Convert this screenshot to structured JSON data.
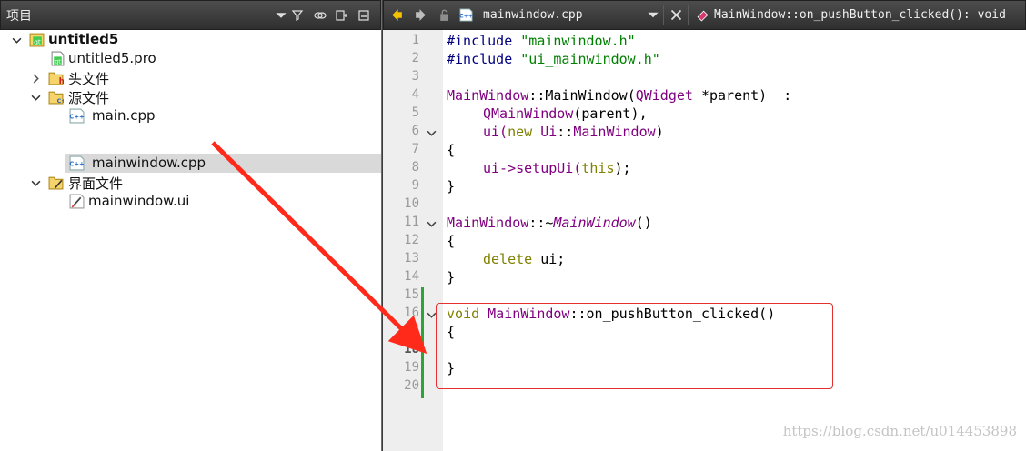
{
  "project_panel": {
    "title": "项目",
    "tree": [
      {
        "label": "untitled5",
        "level": 0,
        "expanded": true,
        "icon": "qt-project-icon",
        "bold": true
      },
      {
        "label": "untitled5.pro",
        "level": 1,
        "icon": "pro-file-icon"
      },
      {
        "label": "头文件",
        "level": 1,
        "expanded": false,
        "icon": "header-folder-icon"
      },
      {
        "label": "源文件",
        "level": 1,
        "expanded": true,
        "icon": "source-folder-icon"
      },
      {
        "label": "main.cpp",
        "level": 2,
        "icon": "cpp-file-icon"
      },
      {
        "label": "mainwindow.cpp",
        "level": 2,
        "icon": "cpp-file-icon",
        "selected": true
      },
      {
        "label": "界面文件",
        "level": 1,
        "expanded": true,
        "icon": "forms-folder-icon"
      },
      {
        "label": "mainwindow.ui",
        "level": 2,
        "icon": "ui-file-icon"
      }
    ]
  },
  "editor": {
    "file_name": "mainwindow.cpp",
    "function_selector": "MainWindow::on_pushButton_clicked(): void",
    "current_line": "18",
    "lines": [
      {
        "num": "1"
      },
      {
        "num": "2"
      },
      {
        "num": "3"
      },
      {
        "num": "4"
      },
      {
        "num": "5"
      },
      {
        "num": "6"
      },
      {
        "num": "7"
      },
      {
        "num": "8"
      },
      {
        "num": "9"
      },
      {
        "num": "10"
      },
      {
        "num": "11"
      },
      {
        "num": "12"
      },
      {
        "num": "13"
      },
      {
        "num": "14"
      },
      {
        "num": "15"
      },
      {
        "num": "16"
      },
      {
        "num": "17"
      },
      {
        "num": "18"
      },
      {
        "num": "19"
      },
      {
        "num": "20"
      }
    ],
    "code": {
      "l1a": "#include ",
      "l1b": "\"mainwindow.h\"",
      "l2a": "#include ",
      "l2b": "\"ui_mainwindow.h\"",
      "l4a": "MainWindow",
      "l4b": "::",
      "l4c": "MainWindow",
      "l4d": "(",
      "l4e": "QWidget",
      "l4f": " *parent)  :",
      "l5a": "QMainWindow",
      "l5b": "(parent),",
      "l6a": "ui(",
      "l6b": "new",
      "l6c": " ",
      "l6d": "Ui",
      "l6e": "::",
      "l6f": "MainWindow",
      "l6g": ")",
      "l7": "{",
      "l8a": "ui->setupUi(",
      "l8b": "this",
      "l8c": ");",
      "l9": "}",
      "l11a": "MainWindow",
      "l11b": "::~",
      "l11c": "MainWindow",
      "l11d": "()",
      "l12": "{",
      "l13a": "delete",
      "l13b": " ui;",
      "l14": "}",
      "l16a": "void",
      "l16b": " ",
      "l16c": "MainWindow",
      "l16d": "::on_pushButton_clicked()",
      "l17": "{",
      "l19": "}"
    }
  },
  "watermark": "https://blog.csdn.net/u014453898",
  "colors": {
    "accent_red": "#e53030",
    "change_bar": "#2fa33a",
    "keyword": "#808000",
    "class": "#800080",
    "string": "#008000"
  }
}
